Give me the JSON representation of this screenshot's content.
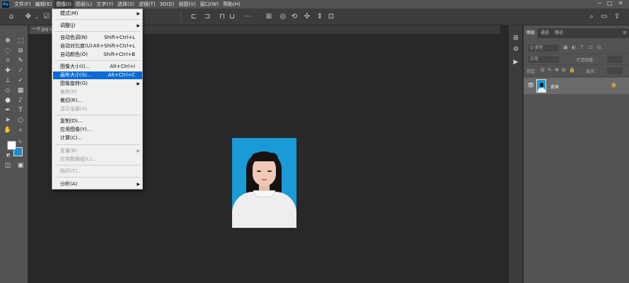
{
  "menubar": {
    "logo": "Ps",
    "items": [
      "文件(F)",
      "编辑(E)",
      "图像(I)",
      "图层(L)",
      "文字(Y)",
      "选择(S)",
      "滤镜(T)",
      "3D(D)",
      "视图(V)",
      "窗口(W)",
      "帮助(H)"
    ]
  },
  "document": {
    "tab_label": "一寸.jpg @"
  },
  "image_menu": {
    "items": [
      {
        "label": "模式(M)",
        "shortcut": "",
        "submenu": true,
        "disabled": false
      },
      {
        "label": "调整(J)",
        "shortcut": "",
        "submenu": true,
        "disabled": false
      },
      {
        "label": "自动色调(N)",
        "shortcut": "Shift+Ctrl+L",
        "submenu": false,
        "disabled": false
      },
      {
        "label": "自动对比度(U)",
        "shortcut": "Alt+Shift+Ctrl+L",
        "submenu": false,
        "disabled": false
      },
      {
        "label": "自动颜色(O)",
        "shortcut": "Shift+Ctrl+B",
        "submenu": false,
        "disabled": false
      },
      {
        "label": "图像大小(I)...",
        "shortcut": "Alt+Ctrl+I",
        "submenu": false,
        "disabled": false
      },
      {
        "label": "画布大小(S)...",
        "shortcut": "Alt+Ctrl+C",
        "submenu": false,
        "disabled": false,
        "highlighted": true
      },
      {
        "label": "图像旋转(G)",
        "shortcut": "",
        "submenu": true,
        "disabled": false
      },
      {
        "label": "裁剪(P)",
        "shortcut": "",
        "submenu": false,
        "disabled": true
      },
      {
        "label": "裁切(R)...",
        "shortcut": "",
        "submenu": false,
        "disabled": false
      },
      {
        "label": "显示全部(V)",
        "shortcut": "",
        "submenu": false,
        "disabled": true
      },
      {
        "label": "复制(D)...",
        "shortcut": "",
        "submenu": false,
        "disabled": false
      },
      {
        "label": "应用图像(Y)...",
        "shortcut": "",
        "submenu": false,
        "disabled": false
      },
      {
        "label": "计算(C)...",
        "shortcut": "",
        "submenu": false,
        "disabled": false
      },
      {
        "label": "变量(B)",
        "shortcut": "",
        "submenu": true,
        "disabled": true
      },
      {
        "label": "应用数据组(L)...",
        "shortcut": "",
        "submenu": false,
        "disabled": true
      },
      {
        "label": "陷印(T)...",
        "shortcut": "",
        "submenu": false,
        "disabled": true
      },
      {
        "label": "分析(A)",
        "shortcut": "",
        "submenu": true,
        "disabled": false
      }
    ]
  },
  "panel": {
    "tabs": [
      "图层",
      "通道",
      "路径"
    ],
    "filter_label": "Q 类型",
    "blend_mode": "正常",
    "opacity_label": "不透明度:",
    "lock_label": "锁定:",
    "fill_label": "填充:",
    "layer": {
      "name": "背景"
    }
  },
  "colors": {
    "accent": "#0a6bd6",
    "photo_bg": "#1a9ad6",
    "background_swatch": "#1a8fd0"
  }
}
